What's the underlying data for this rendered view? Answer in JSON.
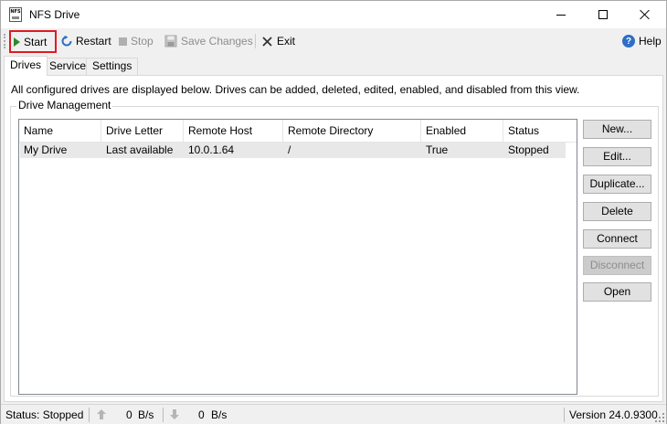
{
  "window": {
    "title": "NFS Drive"
  },
  "toolbar": {
    "start_label": "Start",
    "restart_label": "Restart",
    "stop_label": "Stop",
    "save_label": "Save Changes",
    "exit_label": "Exit",
    "help_label": "Help"
  },
  "tabs": [
    {
      "label": "Drives",
      "active": true
    },
    {
      "label": "Service",
      "active": false
    },
    {
      "label": "Settings",
      "active": false
    }
  ],
  "drives_tab": {
    "intro": "All configured drives are displayed below. Drives can be added, deleted, edited, enabled, and disabled from this view.",
    "group_title": "Drive Management",
    "columns": [
      "Name",
      "Drive Letter",
      "Remote Host",
      "Remote Directory",
      "Enabled",
      "Status"
    ],
    "rows": [
      [
        "My Drive",
        "Last available",
        "10.0.1.64",
        "/",
        "True",
        "Stopped"
      ]
    ],
    "buttons": {
      "new": "New...",
      "edit": "Edit...",
      "duplicate": "Duplicate...",
      "delete": "Delete",
      "connect": "Connect",
      "disconnect": "Disconnect",
      "open": "Open"
    }
  },
  "statusbar": {
    "status": "Status: Stopped",
    "upload_value": "0",
    "upload_unit": "B/s",
    "download_value": "0",
    "download_unit": "B/s",
    "version": "Version 24.0.9300"
  },
  "colors": {
    "highlight": "#e01a22",
    "start_icon": "#2c8a2c",
    "restart_icon": "#2d6fc4",
    "help_icon": "#2d6fc4"
  }
}
